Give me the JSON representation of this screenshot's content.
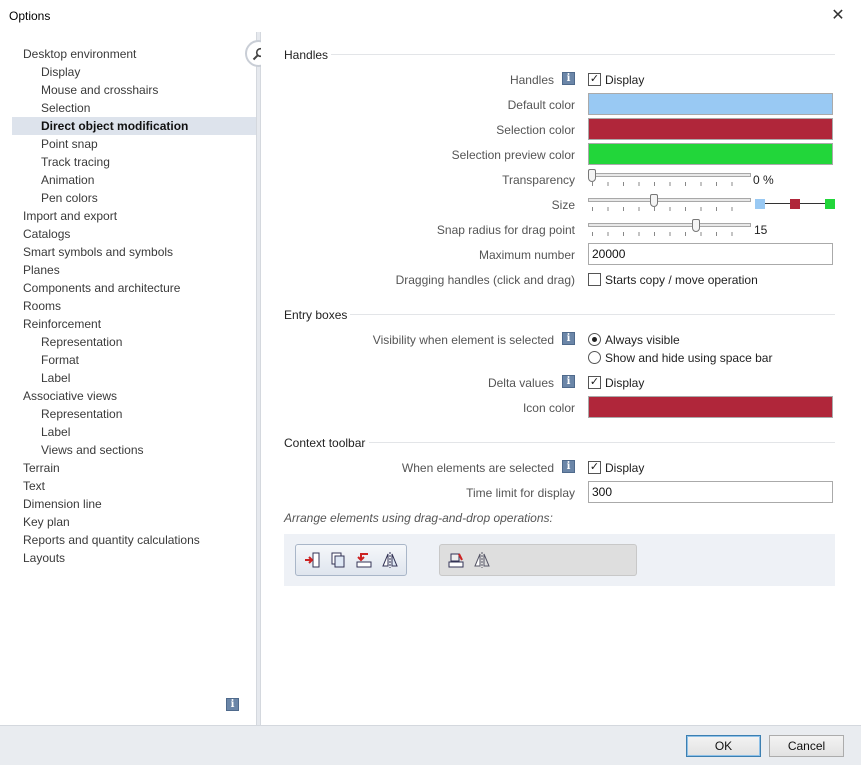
{
  "window": {
    "title": "Options",
    "close_glyph": "✕"
  },
  "tree": {
    "items": [
      {
        "label": "Desktop environment",
        "level": 1
      },
      {
        "label": "Display",
        "level": 2
      },
      {
        "label": "Mouse and crosshairs",
        "level": 2
      },
      {
        "label": "Selection",
        "level": 2
      },
      {
        "label": "Direct object modification",
        "level": 2,
        "selected": true
      },
      {
        "label": "Point snap",
        "level": 2
      },
      {
        "label": "Track tracing",
        "level": 2
      },
      {
        "label": "Animation",
        "level": 2
      },
      {
        "label": "Pen colors",
        "level": 2
      },
      {
        "label": "Import and export",
        "level": 1
      },
      {
        "label": "Catalogs",
        "level": 1
      },
      {
        "label": "Smart symbols and symbols",
        "level": 1
      },
      {
        "label": "Planes",
        "level": 1
      },
      {
        "label": "Components and architecture",
        "level": 1
      },
      {
        "label": "Rooms",
        "level": 1
      },
      {
        "label": "Reinforcement",
        "level": 1
      },
      {
        "label": "Representation",
        "level": 2
      },
      {
        "label": "Format",
        "level": 2
      },
      {
        "label": "Label",
        "level": 2
      },
      {
        "label": "Associative views",
        "level": 1
      },
      {
        "label": "Representation",
        "level": 2
      },
      {
        "label": "Label",
        "level": 2
      },
      {
        "label": "Views and sections",
        "level": 2
      },
      {
        "label": "Terrain",
        "level": 1
      },
      {
        "label": "Text",
        "level": 1
      },
      {
        "label": "Dimension line",
        "level": 1
      },
      {
        "label": "Key plan",
        "level": 1
      },
      {
        "label": "Reports and quantity calculations",
        "level": 1
      },
      {
        "label": "Layouts",
        "level": 1
      }
    ]
  },
  "info_glyph": "i",
  "handles": {
    "title": "Handles",
    "handles_label": "Handles",
    "display_label": "Display",
    "display_checked": true,
    "default_color_label": "Default color",
    "default_color": "#99c9f3",
    "selection_color_label": "Selection color",
    "selection_color": "#b0263a",
    "selection_preview_color_label": "Selection preview color",
    "selection_preview_color": "#22d63a",
    "transparency_label": "Transparency",
    "transparency_value": "0 %",
    "transparency_level": 0,
    "size_label": "Size",
    "size_level": 0.4,
    "snap_radius_label": "Snap radius for drag point",
    "snap_radius_value": "15",
    "snap_radius_level": 0.67,
    "maximum_number_label": "Maximum number",
    "maximum_number_value": "20000",
    "dragging_label": "Dragging handles (click and drag)",
    "dragging_option": "Starts copy / move operation",
    "dragging_checked": false
  },
  "entry_boxes": {
    "title": "Entry boxes",
    "visibility_label": "Visibility when element is selected",
    "option_always": "Always visible",
    "option_space": "Show and hide using space bar",
    "delta_label": "Delta values",
    "delta_display": "Display",
    "delta_checked": true,
    "icon_color_label": "Icon color",
    "icon_color": "#b0263a"
  },
  "context_toolbar": {
    "title": "Context toolbar",
    "when_selected_label": "When elements are selected",
    "when_selected_display": "Display",
    "when_selected_checked": true,
    "time_limit_label": "Time limit for display",
    "time_limit_value": "300",
    "arrange_text": "Arrange elements using drag-and-drop operations:"
  },
  "footer": {
    "ok_label": "OK",
    "cancel_label": "Cancel"
  },
  "check_glyph": "✓"
}
